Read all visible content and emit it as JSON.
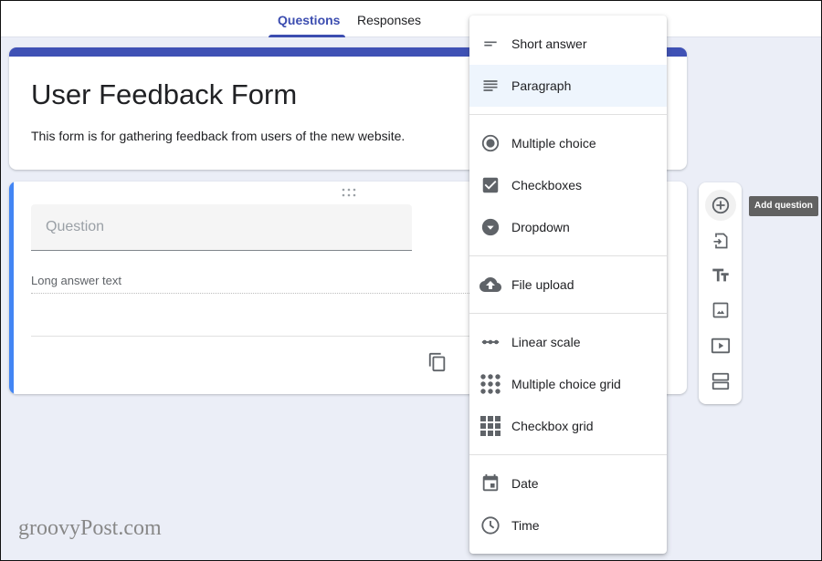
{
  "tabs": [
    {
      "label": "Questions",
      "active": true
    },
    {
      "label": "Responses",
      "active": false
    }
  ],
  "form": {
    "title": "User Feedback Form",
    "description": "This form is for gathering feedback from users of the new website.",
    "accent_color": "#3f51b5"
  },
  "question": {
    "placeholder": "Question",
    "answer_hint": "Long answer text",
    "accent_color": "#4285f4"
  },
  "question_type_menu": {
    "groups": [
      [
        {
          "label": "Short answer",
          "icon": "short-answer-icon",
          "highlighted": false
        },
        {
          "label": "Paragraph",
          "icon": "paragraph-icon",
          "highlighted": true
        }
      ],
      [
        {
          "label": "Multiple choice",
          "icon": "radio-button-icon",
          "highlighted": false
        },
        {
          "label": "Checkboxes",
          "icon": "checkbox-icon",
          "highlighted": false
        },
        {
          "label": "Dropdown",
          "icon": "dropdown-icon",
          "highlighted": false
        }
      ],
      [
        {
          "label": "File upload",
          "icon": "cloud-upload-icon",
          "highlighted": false
        }
      ],
      [
        {
          "label": "Linear scale",
          "icon": "linear-scale-icon",
          "highlighted": false
        },
        {
          "label": "Multiple choice grid",
          "icon": "radio-grid-icon",
          "highlighted": false
        },
        {
          "label": "Checkbox grid",
          "icon": "checkbox-grid-icon",
          "highlighted": false
        }
      ],
      [
        {
          "label": "Date",
          "icon": "calendar-icon",
          "highlighted": false
        },
        {
          "label": "Time",
          "icon": "clock-icon",
          "highlighted": false
        }
      ]
    ]
  },
  "side_toolbar": {
    "tools": [
      {
        "name": "add-question",
        "icon": "add-circle-icon"
      },
      {
        "name": "import-questions",
        "icon": "import-icon"
      },
      {
        "name": "add-title-description",
        "icon": "title-text-icon"
      },
      {
        "name": "add-image",
        "icon": "image-icon"
      },
      {
        "name": "add-video",
        "icon": "video-icon"
      },
      {
        "name": "add-section",
        "icon": "section-icon"
      }
    ],
    "tooltip": "Add question"
  },
  "watermark": "groovyPost.com"
}
